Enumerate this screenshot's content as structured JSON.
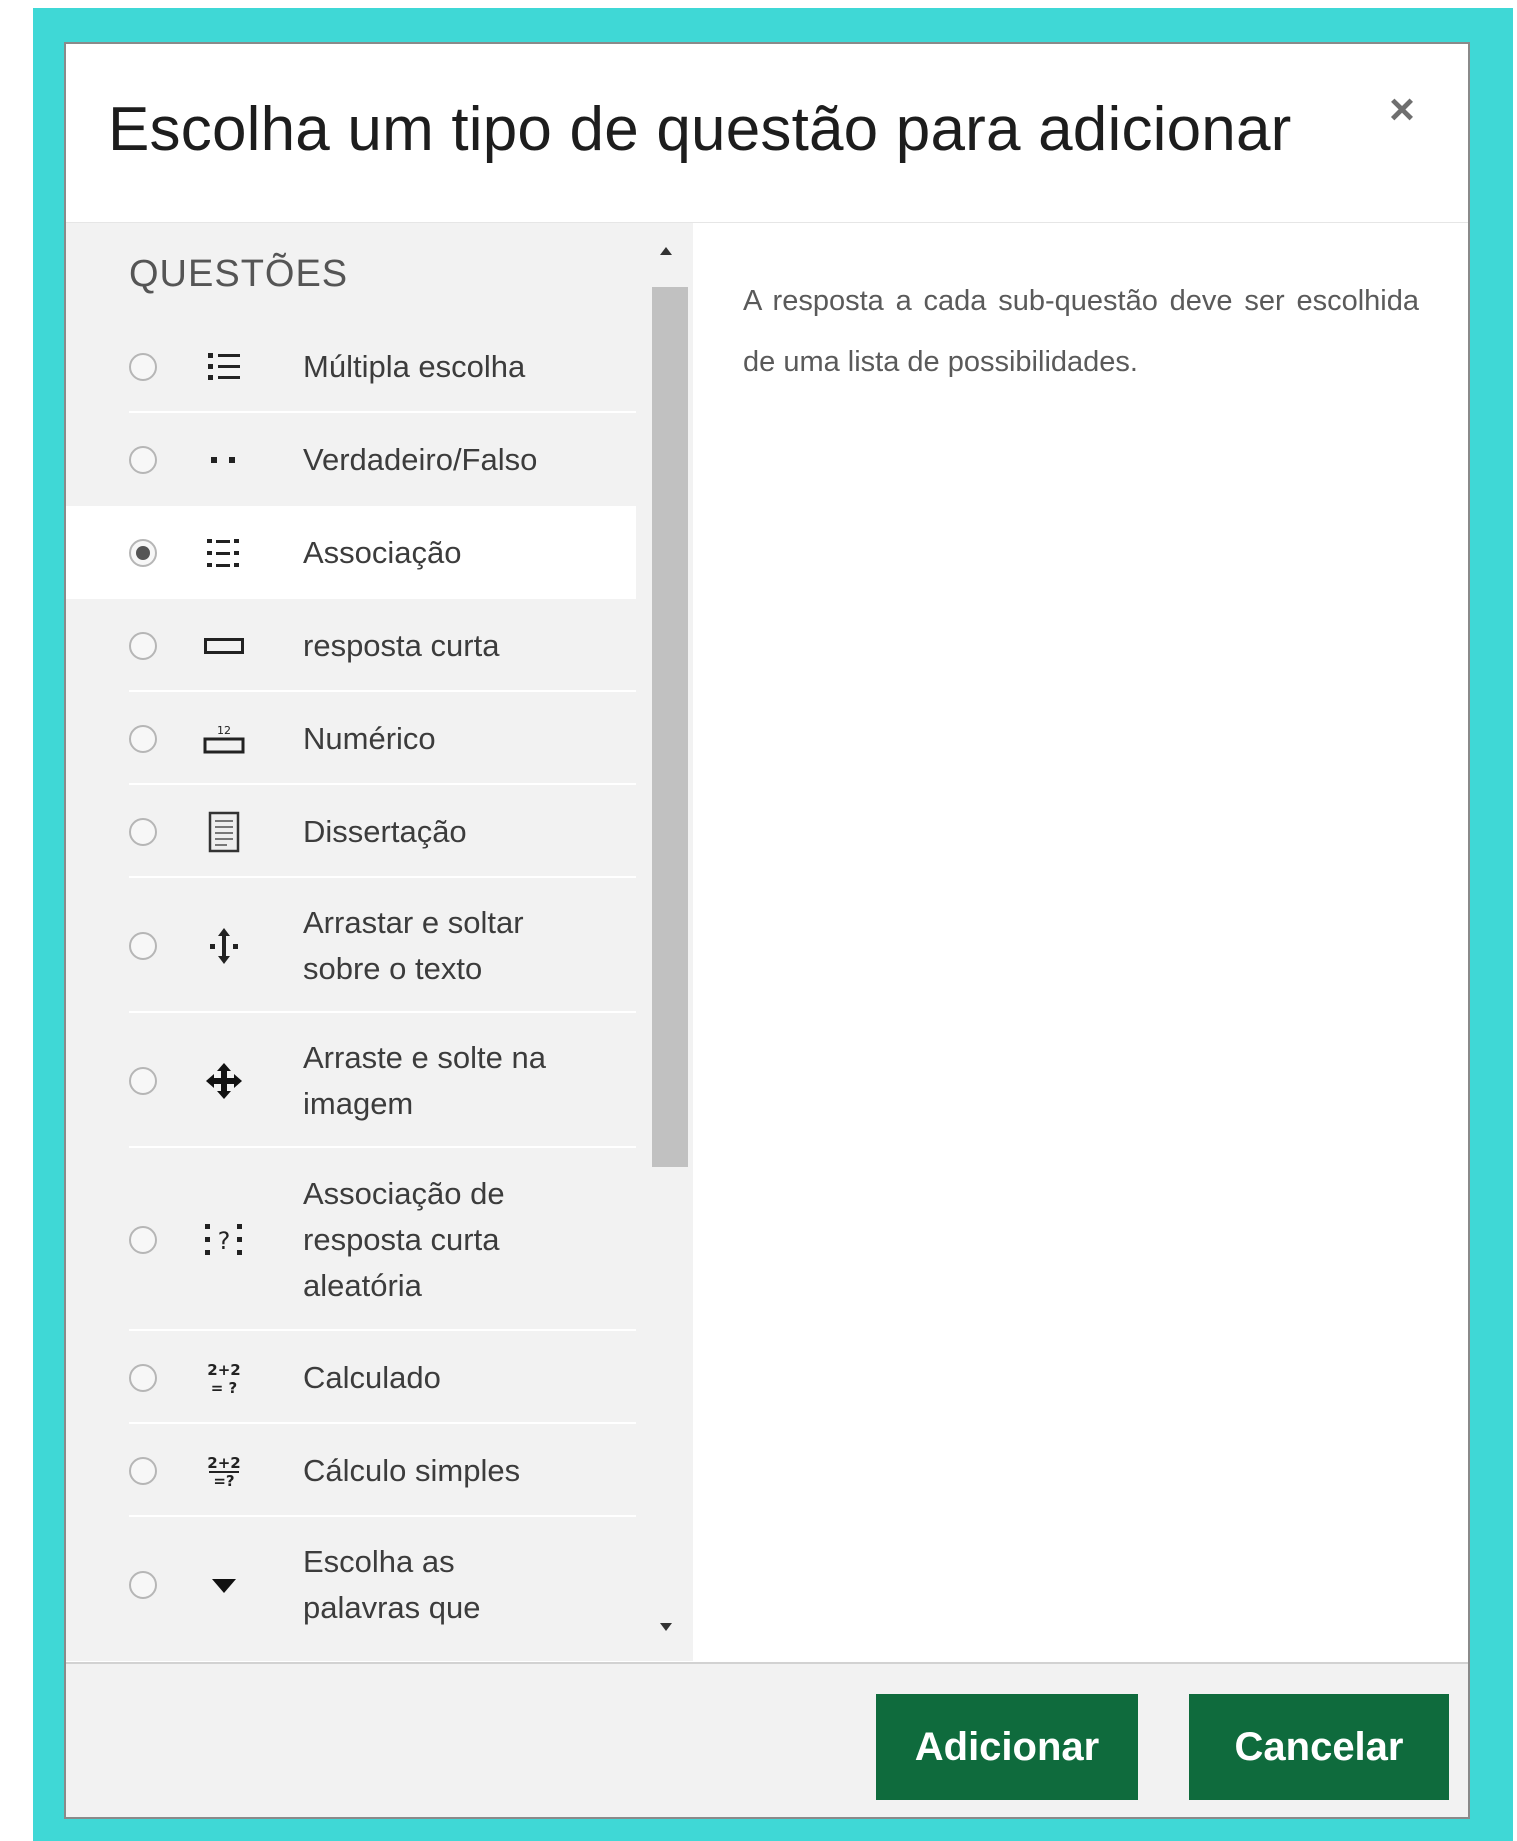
{
  "dialog": {
    "title": "Escolha um tipo de questão para adicionar",
    "close_label": "×"
  },
  "questions": {
    "section_title": "QUESTÕES",
    "options": [
      {
        "label": "Múltipla escolha",
        "icon": "list-icon",
        "selected": false
      },
      {
        "label": "Verdadeiro/Falso",
        "icon": "two-dots-icon",
        "selected": false
      },
      {
        "label": "Associação",
        "icon": "matching-icon",
        "selected": true
      },
      {
        "label": "resposta curta",
        "icon": "short-answer-icon",
        "selected": false
      },
      {
        "label": "Numérico",
        "icon": "numeric-icon",
        "selected": false
      },
      {
        "label": "Dissertação",
        "icon": "essay-icon",
        "selected": false
      },
      {
        "label": "Arrastar e soltar sobre o texto",
        "icon": "drag-drop-text-icon",
        "selected": false
      },
      {
        "label": "Arraste e solte na imagem",
        "icon": "drag-drop-image-icon",
        "selected": false
      },
      {
        "label": "Associação de resposta curta aleatória",
        "icon": "random-match-icon",
        "selected": false
      },
      {
        "label": "Calculado",
        "icon": "calculated-icon",
        "selected": false
      },
      {
        "label": "Cálculo simples",
        "icon": "calculated-simple-icon",
        "selected": false
      },
      {
        "label": "Escolha as palavras que",
        "icon": "dropdown-arrow-icon",
        "selected": false
      }
    ]
  },
  "description": {
    "text": "A resposta a cada sub-questão deve ser escolhida de uma lista de possibilidades."
  },
  "footer": {
    "add_label": "Adicionar",
    "cancel_label": "Cancelar"
  },
  "colors": {
    "frame": "#3fd8d6",
    "button": "#0f6b3d",
    "panel": "#f2f2f2"
  }
}
